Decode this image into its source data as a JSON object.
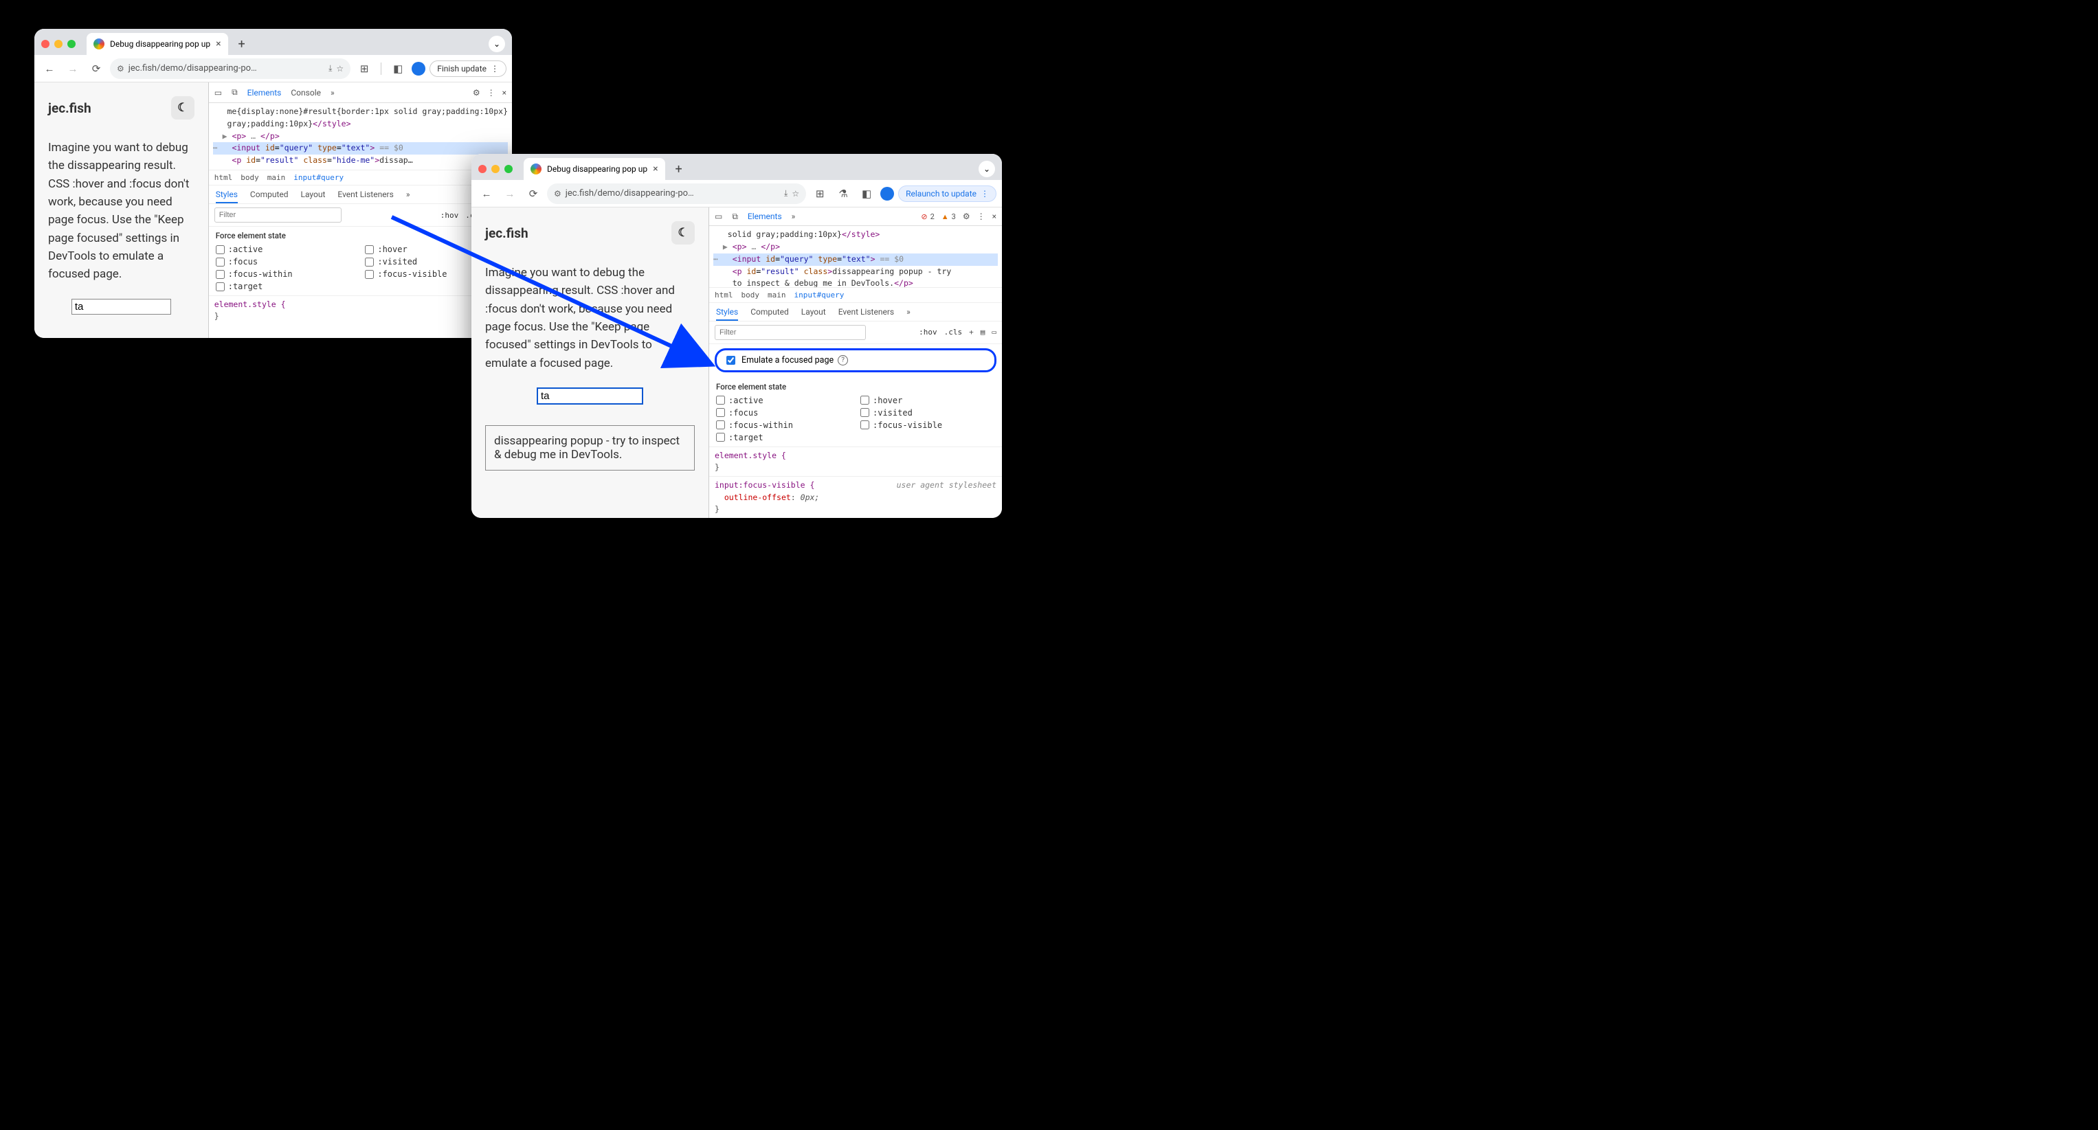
{
  "common": {
    "tab_title": "Debug disappearing pop up",
    "site_title": "jec.fish",
    "paragraph": "Imagine you want to debug the dissappearing result. CSS :hover and :focus don't work, because you need page focus. Use the \"Keep page focused\" settings in DevTools to emulate a focused page.",
    "query_value": "ta",
    "url_display": "jec.fish/demo/disappearing-po…",
    "devtools_tabs": {
      "elements": "Elements",
      "console": "Console"
    },
    "crumbs": [
      "html",
      "body",
      "main",
      "input#query"
    ],
    "subtabs": [
      "Styles",
      "Computed",
      "Layout",
      "Event Listeners"
    ],
    "filter_placeholder": "Filter",
    "filter_opts": [
      ":hov",
      ".cls"
    ],
    "force_title": "Force element state",
    "states": {
      "active": ":active",
      "hover": ":hover",
      "focus": ":focus",
      "visited": ":visited",
      "focus_within": ":focus-within",
      "focus_visible": ":focus-visible",
      "target": ":target"
    },
    "elstyle": "element.style {",
    "brace": "}",
    "highlighted_input": "<input id=\"query\" type=\"text\">",
    "eq0": "== $0"
  },
  "win1": {
    "update_button": "Finish update",
    "dom_line1": "me{display:none}#result{border:1px solid gray;padding:10px}",
    "dom_style_close": "</style>",
    "dom_p_open": "▶ <p>",
    "dom_p_dots": "…",
    "dom_p_close": "</p>",
    "dom_result": "<p id=\"result\" class=\"hide-me\">",
    "dom_result_text": "dissap…"
  },
  "win2": {
    "update_button": "Relaunch to update",
    "error_count": "2",
    "warn_count": "3",
    "result_text": "dissappearing popup - try to inspect & debug me in DevTools.",
    "dom_line1": "solid gray;padding:10px}",
    "dom_style_close": "</style>",
    "dom_result_open": "<p id=\"result\" class>",
    "dom_result_text": "dissappearing popup - try to inspect & debug me in DevTools.",
    "dom_result_close": "</p>",
    "emulate_label": "Emulate a focused page",
    "css2_sel": "input:focus-visible {",
    "css2_prop": "outline-offset",
    "css2_val": "0px;",
    "css2_src": "user agent stylesheet"
  }
}
